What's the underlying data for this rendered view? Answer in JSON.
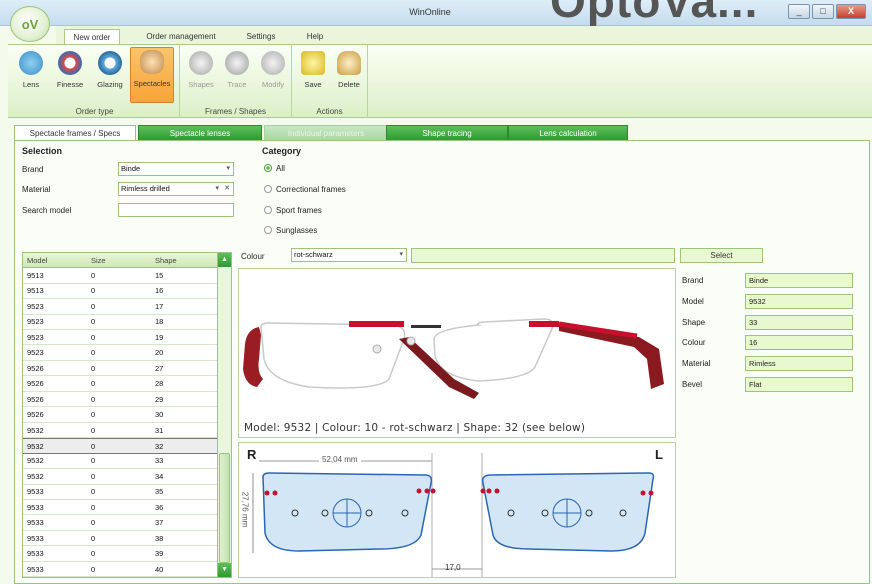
{
  "app": {
    "title": "WinOnline",
    "logo_text": "oV",
    "brand_watermark": "OptoVa..."
  },
  "window_buttons": {
    "minimize": "_",
    "maximize": "□",
    "close": "X"
  },
  "menu": [
    "New order",
    "Order management",
    "Settings",
    "Help"
  ],
  "ribbon": {
    "groups": [
      {
        "caption": "Order type",
        "buttons": [
          "Lens",
          "Finesse",
          "Glazing",
          "Spectacles"
        ]
      },
      {
        "caption": "Frames / Shapes",
        "buttons": [
          "Shapes",
          "Trace",
          "Modify"
        ]
      },
      {
        "caption": "Actions",
        "buttons": [
          "Save",
          "Delete"
        ]
      }
    ]
  },
  "tabs": [
    "Spectacle frames / Specs",
    "Spectacle lenses",
    "Individual parameters",
    "Shape tracing",
    "Lens calculation"
  ],
  "selection": {
    "heading": "Selection",
    "brand_label": "Brand",
    "brand_value": "Binde",
    "material_label": "Material",
    "material_value": "Rimless drilled",
    "search_label": "Search model",
    "search_value": ""
  },
  "category": {
    "heading": "Category",
    "options": [
      "All",
      "Correctional frames",
      "Sport frames",
      "Sunglasses"
    ],
    "selected": "All"
  },
  "table": {
    "headers": [
      "Model",
      "Size",
      "Shape"
    ],
    "rows": [
      [
        "9513",
        "0",
        "15"
      ],
      [
        "9513",
        "0",
        "16"
      ],
      [
        "9523",
        "0",
        "17"
      ],
      [
        "9523",
        "0",
        "18"
      ],
      [
        "9523",
        "0",
        "19"
      ],
      [
        "9523",
        "0",
        "20"
      ],
      [
        "9526",
        "0",
        "27"
      ],
      [
        "9526",
        "0",
        "28"
      ],
      [
        "9526",
        "0",
        "29"
      ],
      [
        "9526",
        "0",
        "30"
      ],
      [
        "9532",
        "0",
        "31"
      ],
      [
        "9532",
        "0",
        "32"
      ],
      [
        "9532",
        "0",
        "33"
      ],
      [
        "9532",
        "0",
        "34"
      ],
      [
        "9533",
        "0",
        "35"
      ],
      [
        "9533",
        "0",
        "36"
      ],
      [
        "9533",
        "0",
        "37"
      ],
      [
        "9533",
        "0",
        "38"
      ],
      [
        "9533",
        "0",
        "39"
      ],
      [
        "9533",
        "0",
        "40"
      ]
    ],
    "selected_row": 11
  },
  "colour": {
    "label": "Colour",
    "value": "rot-schwarz",
    "select_button": "Select"
  },
  "details": [
    {
      "label": "Brand",
      "value": "Binde"
    },
    {
      "label": "Model",
      "value": "9532"
    },
    {
      "label": "Shape",
      "value": "33"
    },
    {
      "label": "Colour",
      "value": "16"
    },
    {
      "label": "Material",
      "value": "Rimless"
    },
    {
      "label": "Bevel",
      "value": "Flat"
    }
  ],
  "photo_caption": "Model: 9532  |  Colour: 10 - rot-schwarz  |  Shape: 32 (see below)",
  "shape_drawing": {
    "right_label": "R",
    "left_label": "L",
    "width": "52,04 mm",
    "height": "27,76 mm",
    "bridge": "17,0"
  },
  "colors": {
    "accent_green": "#2f9a32",
    "frame_red": "#c8102e",
    "lens_blue": "#2a66b3"
  }
}
